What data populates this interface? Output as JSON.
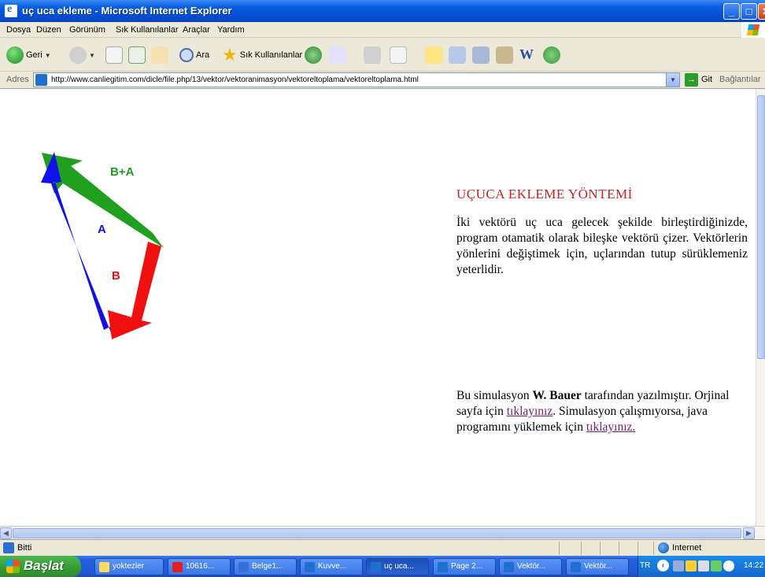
{
  "window": {
    "title": "uç uca ekleme - Microsoft Internet Explorer"
  },
  "menu": [
    "Dosya",
    "Düzen",
    "Görünüm",
    "Sık Kullanılanlar",
    "Araçlar",
    "Yardım"
  ],
  "toolbar": {
    "back_label": "Geri",
    "search_label": "Ara",
    "favorites_label": "Sık Kullanılanlar"
  },
  "address": {
    "label": "Adres",
    "url": "http://www.canliegitim.com/dicle/file.php/13/vektor/vektoranimasyon/vektoreltoplama/vektoreltoplama.html",
    "go_label": "Git",
    "links_label": "Bağlantılar"
  },
  "page": {
    "heading": "UÇUCA EKLEME YÖNTEMİ",
    "paragraph": "İki vektörü uç uca gelecek şekilde birleştirdiğinizde, program otamatik olarak bileşke vektörü çizer. Vektörlerin yönlerini değiştimek için, uçlarından tutup sürüklemeniz yeterlidir.",
    "credit_pre": "Bu simulasyon ",
    "credit_author": "W. Bauer",
    "credit_mid": " tarafından yazılmıştır. Orjinal sayfa için ",
    "credit_link1": "tıklayınız",
    "credit_mid2": ". Simulasyon çalışmıyorsa, java programını yüklemek için ",
    "credit_link2": "tıklayınız."
  },
  "vectors": {
    "label_sum": "B+A",
    "label_a": "A",
    "label_b": "B",
    "color_sum": "#1fa01f",
    "color_a": "#1010e8",
    "color_b": "#f01010"
  },
  "status": {
    "text": "Bitti",
    "zone": "Internet"
  },
  "taskbar": {
    "start": "Başlat",
    "tasks": [
      "yoktezler",
      "10616...",
      "Belge1...",
      "Kuvve...",
      "uç uca...",
      "Page 2...",
      "Vektör...",
      "Vektör..."
    ],
    "lang": "TR",
    "clock": "14:22"
  }
}
